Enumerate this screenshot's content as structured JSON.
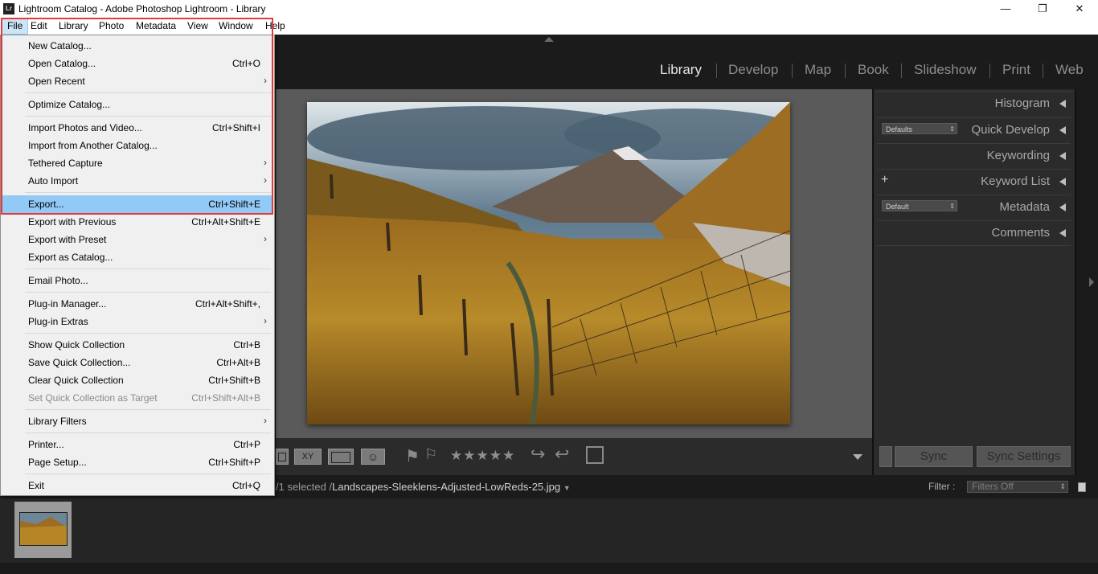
{
  "window": {
    "icon_text": "Lr",
    "title": "Lightroom Catalog - Adobe Photoshop Lightroom - Library",
    "minimize": "—",
    "restore": "❐",
    "close": "✕"
  },
  "menubar": [
    "File",
    "Edit",
    "Library",
    "Photo",
    "Metadata",
    "View",
    "Window",
    "Help"
  ],
  "modules": [
    "Library",
    "Develop",
    "Map",
    "Book",
    "Slideshow",
    "Print",
    "Web"
  ],
  "right_panel": {
    "histogram": "Histogram",
    "quick_develop": "Quick Develop",
    "quick_develop_preset": "Defaults",
    "keywording": "Keywording",
    "keyword_list": "Keyword List",
    "metadata": "Metadata",
    "metadata_preset": "Default",
    "comments": "Comments"
  },
  "toolbar": {
    "view_xy": "XY",
    "stars": "★★★★★",
    "sync": "Sync",
    "sync_settings": "Sync Settings"
  },
  "filmstrip_bar": {
    "selection_prefix": "/1 selected /",
    "filename": "Landscapes-Sleeklens-Adjusted-LowReds-25.jpg",
    "filter_label": "Filter :",
    "filter_value": "Filters Off"
  },
  "file_menu": {
    "new_catalog": "New Catalog...",
    "open_catalog": "Open Catalog...",
    "open_catalog_sc": "Ctrl+O",
    "open_recent": "Open Recent",
    "optimize_catalog": "Optimize Catalog...",
    "import_photos": "Import Photos and Video...",
    "import_photos_sc": "Ctrl+Shift+I",
    "import_other": "Import from Another Catalog...",
    "tethered_capture": "Tethered Capture",
    "auto_import": "Auto Import",
    "export": "Export...",
    "export_sc": "Ctrl+Shift+E",
    "export_previous": "Export with Previous",
    "export_previous_sc": "Ctrl+Alt+Shift+E",
    "export_preset": "Export with Preset",
    "export_catalog": "Export as Catalog...",
    "email_photo": "Email Photo...",
    "plugin_manager": "Plug-in Manager...",
    "plugin_manager_sc": "Ctrl+Alt+Shift+,",
    "plugin_extras": "Plug-in Extras",
    "show_quick": "Show Quick Collection",
    "show_quick_sc": "Ctrl+B",
    "save_quick": "Save Quick Collection...",
    "save_quick_sc": "Ctrl+Alt+B",
    "clear_quick": "Clear Quick Collection",
    "clear_quick_sc": "Ctrl+Shift+B",
    "set_quick_target": "Set Quick Collection as Target",
    "set_quick_target_sc": "Ctrl+Shift+Alt+B",
    "library_filters": "Library Filters",
    "printer": "Printer...",
    "printer_sc": "Ctrl+P",
    "page_setup": "Page Setup...",
    "page_setup_sc": "Ctrl+Shift+P",
    "exit": "Exit",
    "exit_sc": "Ctrl+Q",
    "submenu_arrow": "›"
  },
  "colors": {
    "highlight": "#91c9f7",
    "annotation_box": "#e03c3c",
    "panel_bg": "#2b2b2b"
  }
}
